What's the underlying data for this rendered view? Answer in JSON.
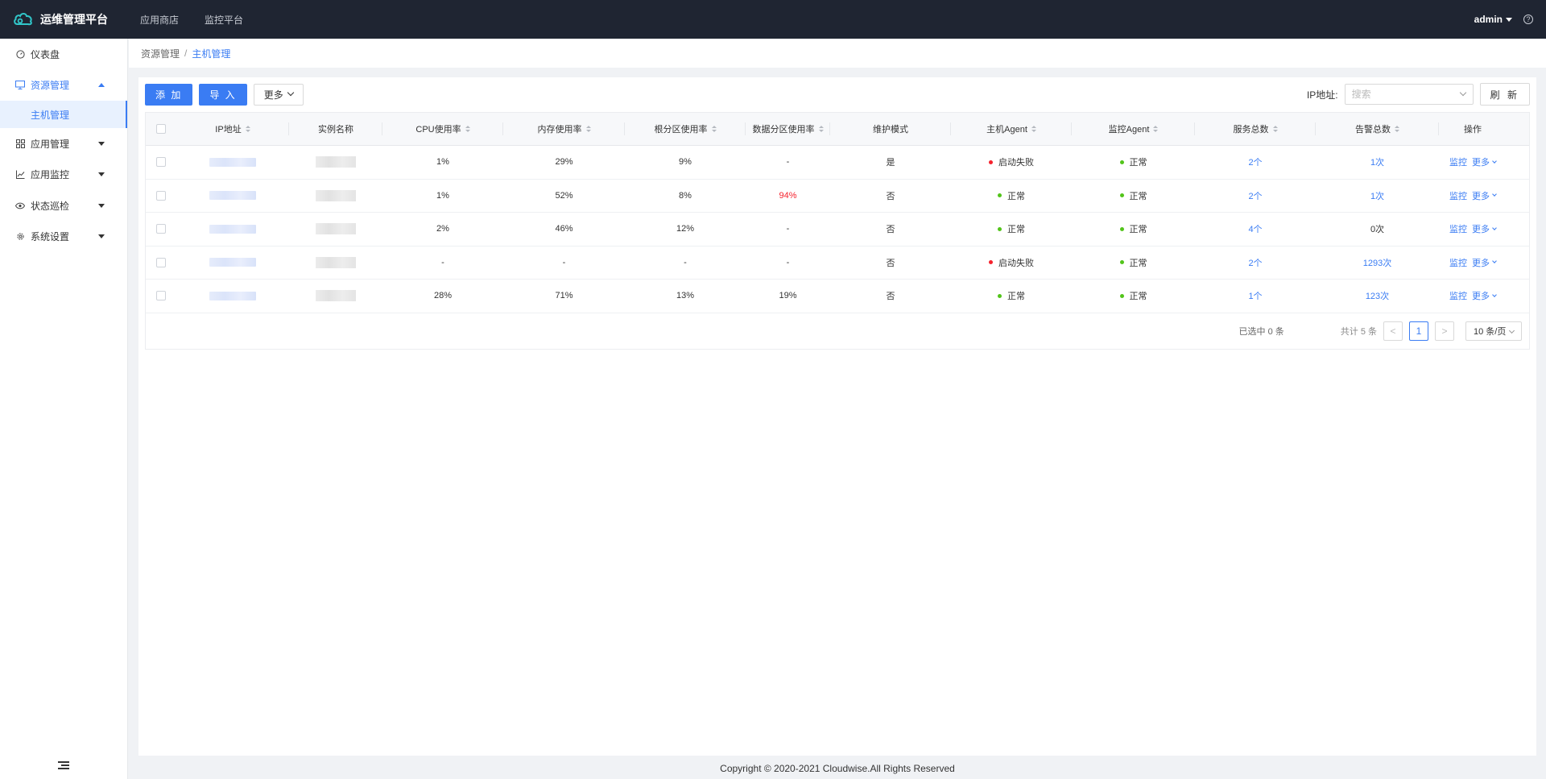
{
  "app": {
    "title": "运维管理平台",
    "topnav": [
      "应用商店",
      "监控平台"
    ],
    "user": "admin",
    "help_icon": "?"
  },
  "sidebar": {
    "items": [
      {
        "label": "仪表盘",
        "icon": "dashboard-icon"
      },
      {
        "label": "资源管理",
        "icon": "monitor-icon",
        "open": true
      },
      {
        "label": "应用管理",
        "icon": "apps-icon"
      },
      {
        "label": "应用监控",
        "icon": "chart-line-icon"
      },
      {
        "label": "状态巡检",
        "icon": "eye-icon"
      },
      {
        "label": "系统设置",
        "icon": "gear-icon"
      }
    ],
    "subitems": [
      {
        "label": "主机管理",
        "active": true
      }
    ]
  },
  "breadcrumb": {
    "parent": "资源管理",
    "sep": "/",
    "current": "主机管理"
  },
  "toolbar": {
    "add_label": "添 加",
    "import_label": "导 入",
    "more_label": "更多",
    "ip_label": "IP地址:",
    "search_placeholder": "搜索",
    "refresh_label": "刷 新"
  },
  "table": {
    "headers": {
      "ip": "IP地址",
      "name": "实例名称",
      "cpu": "CPU使用率",
      "mem": "内存使用率",
      "root": "根分区使用率",
      "data": "数据分区使用率",
      "maint": "维护模式",
      "hagent": "主机Agent",
      "magent": "监控Agent",
      "svc": "服务总数",
      "alarm": "告警总数",
      "ops": "操作"
    },
    "rows": [
      {
        "cpu": "1%",
        "mem": "29%",
        "root": "9%",
        "data": "-",
        "data_alert": false,
        "maint": "是",
        "hagent": "启动失败",
        "hagent_status": "error",
        "magent": "正常",
        "magent_status": "ok",
        "svc": "2个",
        "alarm": "1次",
        "alarm_link": true
      },
      {
        "cpu": "1%",
        "mem": "52%",
        "root": "8%",
        "data": "94%",
        "data_alert": true,
        "maint": "否",
        "hagent": "正常",
        "hagent_status": "ok",
        "magent": "正常",
        "magent_status": "ok",
        "svc": "2个",
        "alarm": "1次",
        "alarm_link": true
      },
      {
        "cpu": "2%",
        "mem": "46%",
        "root": "12%",
        "data": "-",
        "data_alert": false,
        "maint": "否",
        "hagent": "正常",
        "hagent_status": "ok",
        "magent": "正常",
        "magent_status": "ok",
        "svc": "4个",
        "alarm": "0次",
        "alarm_link": false
      },
      {
        "cpu": "-",
        "mem": "-",
        "root": "-",
        "data": "-",
        "data_alert": false,
        "maint": "否",
        "hagent": "启动失败",
        "hagent_status": "error",
        "magent": "正常",
        "magent_status": "ok",
        "svc": "2个",
        "alarm": "1293次",
        "alarm_link": true
      },
      {
        "cpu": "28%",
        "mem": "71%",
        "root": "13%",
        "data": "19%",
        "data_alert": false,
        "maint": "否",
        "hagent": "正常",
        "hagent_status": "ok",
        "magent": "正常",
        "magent_status": "ok",
        "svc": "1个",
        "alarm": "123次",
        "alarm_link": true
      }
    ],
    "ops": {
      "monitor": "监控",
      "more": "更多"
    }
  },
  "pager": {
    "selected": "已选中 0 条",
    "total": "共计 5 条",
    "prev": "<",
    "page": "1",
    "next": ">",
    "page_size": "10 条/页"
  },
  "footer": "Copyright © 2020-2021 Cloudwise.All Rights Reserved",
  "colors": {
    "accent": "#3a7cf3",
    "topbar": "#1f2532",
    "error": "#f5222d",
    "ok": "#52c41a"
  }
}
